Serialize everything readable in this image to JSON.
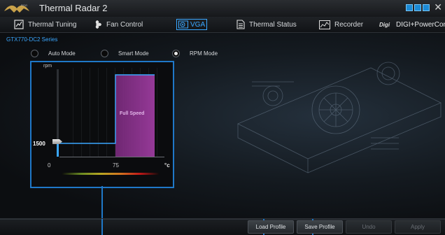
{
  "window": {
    "title": "Thermal Radar 2",
    "brand": "REPUBLIC OF GAMERS",
    "close_glyph": "✕"
  },
  "nav": {
    "tabs": [
      {
        "label": "Thermal Tuning",
        "icon": "thermal-tuning-icon",
        "active": false
      },
      {
        "label": "Fan Control",
        "icon": "fan-icon",
        "active": false
      },
      {
        "label": "VGA",
        "icon": "vga-icon",
        "active": true
      },
      {
        "label": "Thermal Status",
        "icon": "thermal-status-icon",
        "active": false
      },
      {
        "label": "Recorder",
        "icon": "recorder-icon",
        "active": false
      },
      {
        "label": "DIGI+PowerControl",
        "prefix": "DIGI+",
        "icon": "digi-icon",
        "active": false
      }
    ]
  },
  "vga": {
    "series": "GTX770-DC2 Series",
    "modes": [
      {
        "label": "Auto Mode",
        "selected": false
      },
      {
        "label": "Smart Mode",
        "selected": false
      },
      {
        "label": "RPM Mode",
        "selected": true
      }
    ],
    "graph": {
      "y_label": "rpm",
      "rpm_value": "1500",
      "x_min": "0",
      "x_mid": "75",
      "x_unit": "°c",
      "full_speed_label": "Full Speed"
    }
  },
  "footer": {
    "buttons": [
      {
        "label": "Load Profile",
        "enabled": true
      },
      {
        "label": "Save Profile",
        "enabled": true
      },
      {
        "label": "Undo",
        "enabled": false
      },
      {
        "label": "Apply",
        "enabled": false
      }
    ]
  },
  "colors": {
    "accent": "#1f78c8",
    "highlight": "#3aa7ff",
    "full_speed": "#a43ea6"
  }
}
